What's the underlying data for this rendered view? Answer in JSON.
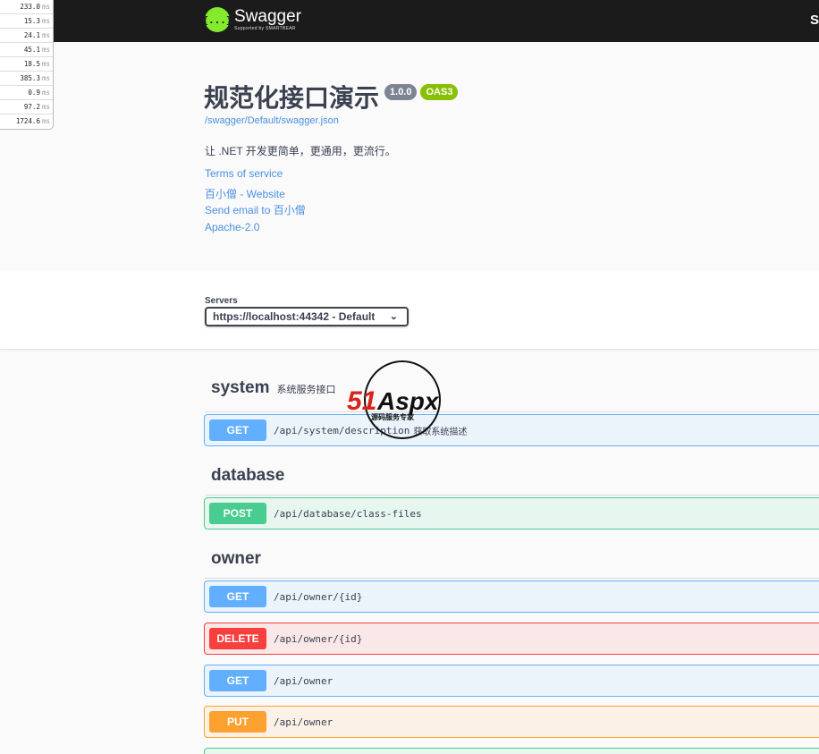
{
  "topbar": {
    "logo_glyph": "{...}",
    "brand": "Swagger",
    "brand_sub": "Supported by SMARTBEAR",
    "right_text": "S"
  },
  "info": {
    "title": "规范化接口演示",
    "version": "1.0.0",
    "oas": "OAS3",
    "url": "/swagger/Default/swagger.json",
    "description": "让 .NET 开发更简单，更通用，更流行。",
    "links": [
      "Terms of service",
      "百小僧 - Website",
      "Send email to 百小僧",
      "Apache-2.0"
    ]
  },
  "servers": {
    "label": "Servers",
    "selected": "https://localhost:44342 - Default"
  },
  "tags": [
    {
      "name": "system",
      "description": "系统服务接口",
      "operations": [
        {
          "method": "GET",
          "path": "/api/system/description",
          "summary": "获取系统描述"
        }
      ]
    },
    {
      "name": "database",
      "description": "",
      "operations": [
        {
          "method": "POST",
          "path": "/api/database/class-files",
          "summary": ""
        }
      ]
    },
    {
      "name": "owner",
      "description": "",
      "operations": [
        {
          "method": "GET",
          "path": "/api/owner/{id}",
          "summary": ""
        },
        {
          "method": "DELETE",
          "path": "/api/owner/{id}",
          "summary": ""
        },
        {
          "method": "GET",
          "path": "/api/owner",
          "summary": ""
        },
        {
          "method": "PUT",
          "path": "/api/owner",
          "summary": ""
        }
      ]
    }
  ],
  "timings": {
    "unit": "ms",
    "values": [
      "233.0",
      "15.3",
      "24.1",
      "45.1",
      "18.5",
      "385.3",
      "0.9",
      "97.2",
      "1724.6"
    ]
  },
  "watermark": {
    "brand": "51Aspx",
    "sub": "源码服务专家"
  },
  "colors": {
    "topbar": "#1b1b1b",
    "logo": "#85ea2d",
    "get": "#61affe",
    "post": "#49cc90",
    "delete": "#f93e3e",
    "put": "#fca130",
    "link": "#4990e2"
  }
}
